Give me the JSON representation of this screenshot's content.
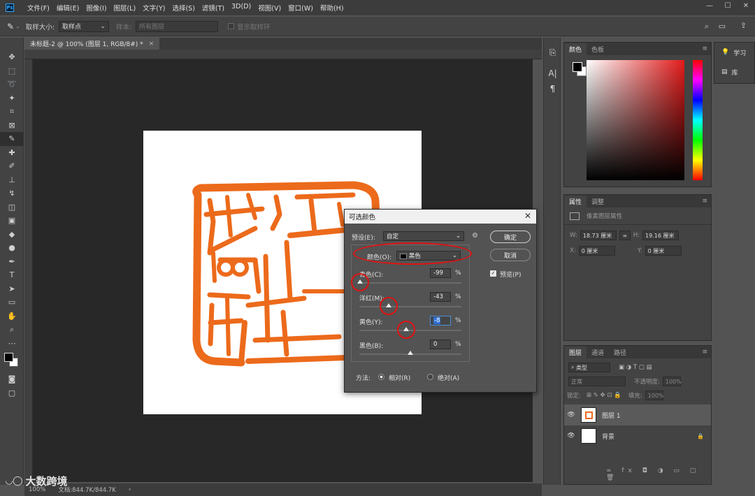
{
  "menu": {
    "logo": "Ps",
    "items": [
      "文件(F)",
      "编辑(E)",
      "图像(I)",
      "图层(L)",
      "文字(Y)",
      "选择(S)",
      "滤镜(T)",
      "3D(D)",
      "视图(V)",
      "窗口(W)",
      "帮助(H)"
    ],
    "win_min": "—",
    "win_max": "☐",
    "win_close": "✕"
  },
  "options": {
    "sample_size_label": "取样大小:",
    "sample_size_value": "取样点",
    "sample_label": "样本:",
    "sample_value": "所有图层",
    "show_ring_label": "显示取样环"
  },
  "document": {
    "tab_title": "未标题-2 @ 100% (图层 1, RGB/8#) *",
    "tab_close": "×",
    "zoom": "100%",
    "doc_size": "文档:844.7K/844.7K",
    "status_arrow": "›"
  },
  "color_panel": {
    "tabs": [
      "颜色",
      "色板"
    ],
    "menu": "≡"
  },
  "properties_panel": {
    "tabs": [
      "属性",
      "调整"
    ],
    "menu": "≡",
    "pixel_label": "像素图层属性",
    "w_label": "W:",
    "w_value": "18.73 厘米",
    "h_label": "H:",
    "h_value": "19.16 厘米",
    "x_label": "X:",
    "x_value": "0 厘米",
    "y_label": "Y:",
    "y_value": "0 厘米",
    "link_icon": "∞"
  },
  "layers_panel": {
    "tabs": [
      "图层",
      "通道",
      "路径"
    ],
    "menu": "≡",
    "filter_label": "类型",
    "blend_mode": "正常",
    "opacity_label": "不透明度:",
    "opacity_value": "100%",
    "lock_label": "锁定:",
    "fill_label": "填充:",
    "fill_value": "100%",
    "layers": [
      {
        "name": "图层 1",
        "selected": true
      },
      {
        "name": "背景",
        "selected": false
      }
    ],
    "lock_icon": "🔒"
  },
  "learn_panel": {
    "items": [
      "学习",
      "库"
    ]
  },
  "dialog": {
    "title": "可选颜色",
    "close": "✕",
    "preset_label": "预设(E):",
    "preset_value": "自定",
    "colors_label": "颜色(O):",
    "colors_value": "黑色",
    "ok": "确定",
    "cancel": "取消",
    "preview_label": "预览(P)",
    "sliders": [
      {
        "label": "青色(C):",
        "value": "-99",
        "unit": "%",
        "level": -99
      },
      {
        "label": "洋红(M):",
        "value": "-43",
        "unit": "%",
        "level": -43
      },
      {
        "label": "黄色(Y):",
        "value": "-8",
        "unit": "%",
        "level": -8
      },
      {
        "label": "黑色(B):",
        "value": "0",
        "unit": "%",
        "level": 0
      }
    ],
    "method_label": "方法:",
    "method_relative": "相对(R)",
    "method_absolute": "绝对(A)"
  },
  "watermark": {
    "text": "大数跨境"
  },
  "colors": {
    "seal": "#ec6a1b",
    "annotation": "#e01212",
    "canvas": "#ffffff"
  }
}
